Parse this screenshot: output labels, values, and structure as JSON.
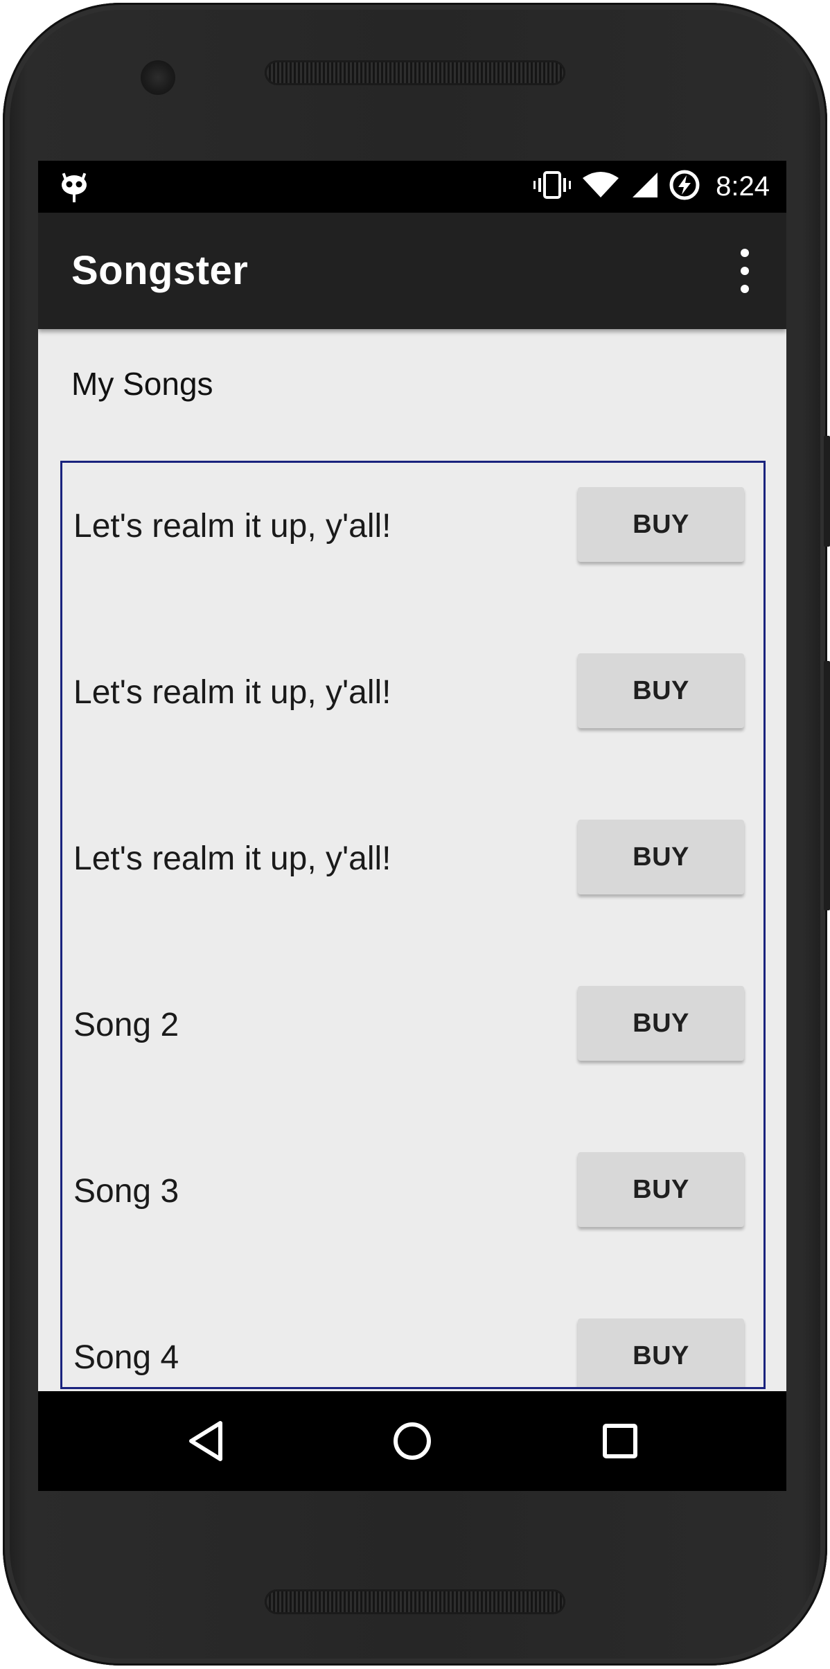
{
  "status_bar": {
    "time": "8:24",
    "icons": [
      "cyanogenmod-mascot-icon",
      "vibrate-icon",
      "wifi-icon",
      "cell-signal-icon",
      "battery-charging-icon"
    ]
  },
  "app_bar": {
    "title": "Songster",
    "overflow_icon": "more-vert-icon"
  },
  "section": {
    "title": "My Songs"
  },
  "songs": [
    {
      "title": "Let's realm it up, y'all!",
      "button_label": "BUY"
    },
    {
      "title": "Let's realm it up, y'all!",
      "button_label": "BUY"
    },
    {
      "title": "Let's realm it up, y'all!",
      "button_label": "BUY"
    },
    {
      "title": "Song 2",
      "button_label": "BUY"
    },
    {
      "title": "Song 3",
      "button_label": "BUY"
    },
    {
      "title": "Song 4",
      "button_label": "BUY"
    }
  ],
  "nav_bar": {
    "icons": [
      "back-icon",
      "home-icon",
      "recents-icon"
    ]
  },
  "colors": {
    "app_bar": "#212121",
    "content_background": "#ececec",
    "list_border": "#1a237e",
    "button_background": "#d8d8d8"
  }
}
